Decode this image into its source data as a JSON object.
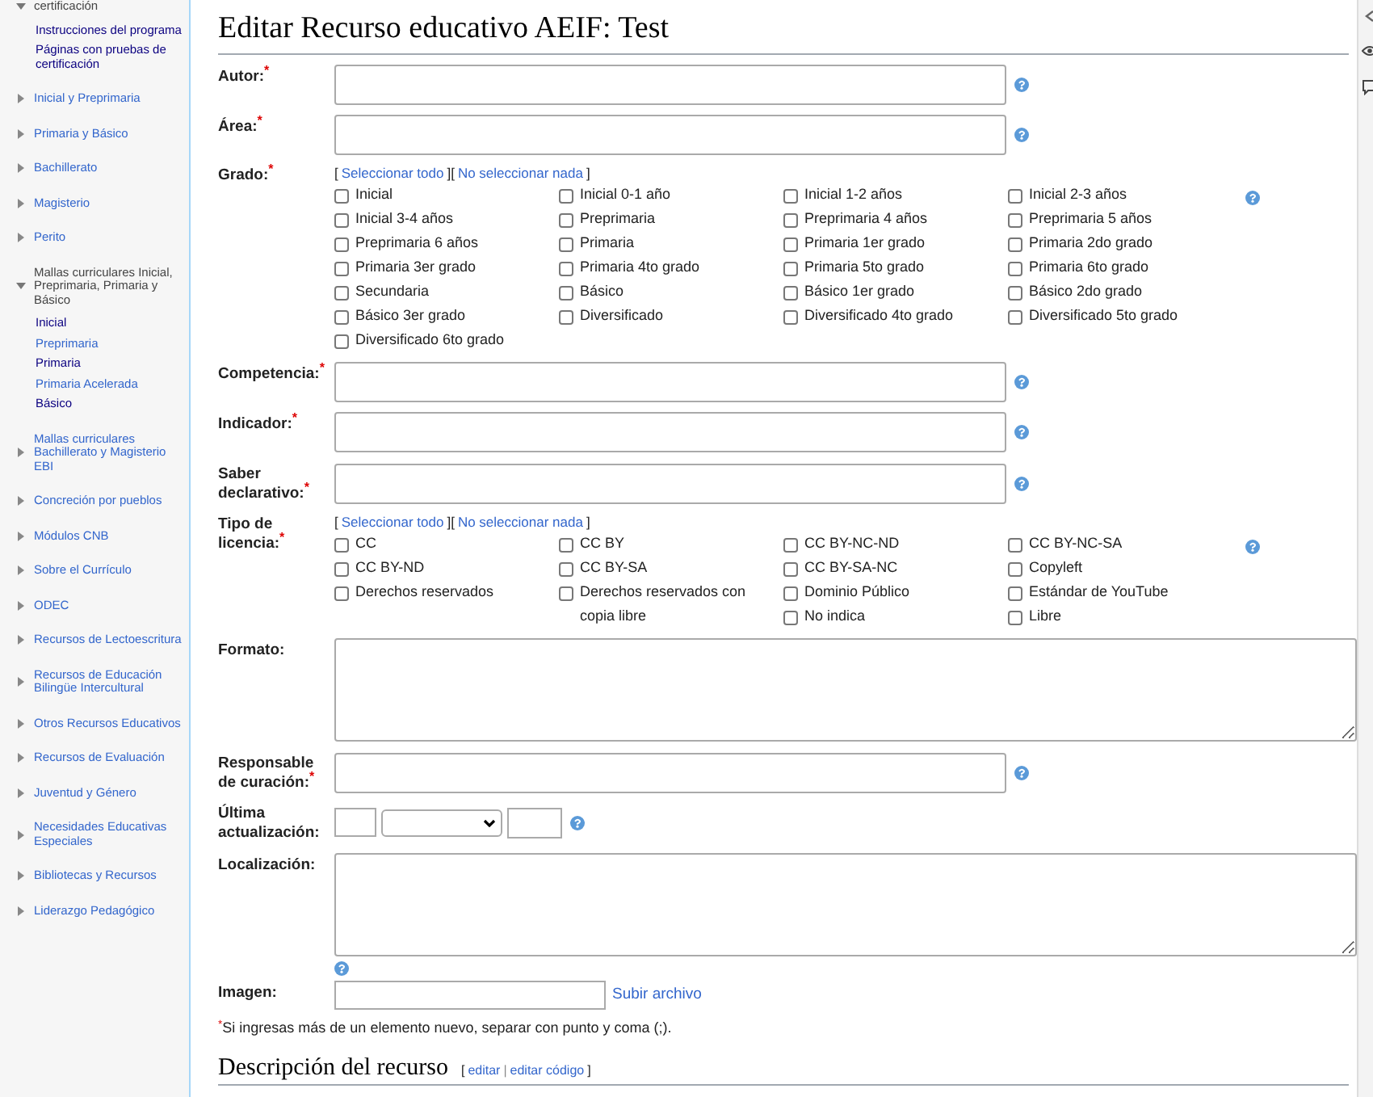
{
  "sidebar": {
    "items": [
      {
        "label": "certificación",
        "expanded": true,
        "children": [
          {
            "label": "Instrucciones del programa",
            "visited": true
          },
          {
            "label": "Páginas con pruebas de certificación",
            "visited": true
          }
        ]
      },
      {
        "label": "Inicial y Preprimaria",
        "expanded": false
      },
      {
        "label": "Primaria y Básico",
        "expanded": false
      },
      {
        "label": "Bachillerato",
        "expanded": false
      },
      {
        "label": "Magisterio",
        "expanded": false
      },
      {
        "label": "Perito",
        "expanded": false
      },
      {
        "label": "Mallas curriculares Inicial, Preprimaria, Primaria y Básico",
        "expanded": true,
        "children": [
          {
            "label": "Inicial",
            "visited": true
          },
          {
            "label": "Preprimaria",
            "visited": false
          },
          {
            "label": "Primaria",
            "visited": true
          },
          {
            "label": "Primaria Acelerada",
            "visited": false
          },
          {
            "label": "Básico",
            "visited": true
          }
        ]
      },
      {
        "label": "Mallas curriculares Bachillerato y Magisterio EBI",
        "expanded": false
      },
      {
        "label": "Concreción por pueblos",
        "expanded": false
      },
      {
        "label": "Módulos CNB",
        "expanded": false
      },
      {
        "label": "Sobre el Currículo",
        "expanded": false
      },
      {
        "label": "ODEC",
        "expanded": false
      },
      {
        "label": "Recursos de Lectoescritura",
        "expanded": false
      },
      {
        "label": "Recursos de Educación Bilingüe Intercultural",
        "expanded": false
      },
      {
        "label": "Otros Recursos Educativos",
        "expanded": false
      },
      {
        "label": "Recursos de Evaluación",
        "expanded": false
      },
      {
        "label": "Juventud y Género",
        "expanded": false
      },
      {
        "label": "Necesidades Educativas Especiales",
        "expanded": false
      },
      {
        "label": "Bibliotecas y Recursos",
        "expanded": false
      },
      {
        "label": "Liderazgo Pedagógico",
        "expanded": false
      }
    ]
  },
  "title": "Editar Recurso educativo AEIF: Test",
  "required_mark": "*",
  "fields": [
    {
      "kind": "text",
      "label": "Autor:",
      "required": true
    },
    {
      "kind": "text",
      "label": "Área:",
      "required": true
    },
    {
      "kind": "checkboxes",
      "label": "Grado:",
      "required": true,
      "brackets": [
        "[",
        "][",
        "]"
      ],
      "select_all": "Seleccionar todo",
      "select_none": "No seleccionar nada",
      "columns": [
        [
          {
            "label": "Inicial",
            "checked": false
          },
          {
            "label": "Inicial 3-4 años",
            "checked": false
          },
          {
            "label": "Preprimaria 6 años",
            "checked": false
          },
          {
            "label": "Primaria 3er grado",
            "checked": false
          },
          {
            "label": "Secundaria",
            "checked": false
          },
          {
            "label": "Básico 3er grado",
            "checked": false
          },
          {
            "label": "Diversificado 6to grado",
            "checked": false
          }
        ],
        [
          {
            "label": "Inicial 0-1 año",
            "checked": false
          },
          {
            "label": "Preprimaria",
            "checked": false
          },
          {
            "label": "Primaria",
            "checked": false
          },
          {
            "label": "Primaria 4to grado",
            "checked": false
          },
          {
            "label": "Básico",
            "checked": false
          },
          {
            "label": "Diversificado",
            "checked": false
          }
        ],
        [
          {
            "label": "Inicial 1-2 años",
            "checked": false
          },
          {
            "label": "Preprimaria 4 años",
            "checked": false
          },
          {
            "label": "Primaria 1er grado",
            "checked": false
          },
          {
            "label": "Primaria 5to grado",
            "checked": false
          },
          {
            "label": "Básico 1er grado",
            "checked": false
          },
          {
            "label": "Diversificado 4to grado",
            "checked": false
          }
        ],
        [
          {
            "label": "Inicial 2-3 años",
            "checked": false
          },
          {
            "label": "Preprimaria 5 años",
            "checked": false
          },
          {
            "label": "Primaria 2do grado",
            "checked": false
          },
          {
            "label": "Primaria 6to grado",
            "checked": false
          },
          {
            "label": "Básico 2do grado",
            "checked": false
          },
          {
            "label": "Diversificado 5to grado",
            "checked": false
          }
        ]
      ]
    },
    {
      "kind": "text",
      "label": "Competencia:",
      "required": true
    },
    {
      "kind": "text",
      "label": "Indicador:",
      "required": true
    },
    {
      "kind": "text",
      "label": "Saber declarativo:",
      "required": true
    },
    {
      "kind": "checkboxes",
      "label": "Tipo de licencia:",
      "required": true,
      "brackets": [
        "[",
        "][",
        "]"
      ],
      "select_all": "Seleccionar todo",
      "select_none": "No seleccionar nada",
      "columns": [
        [
          {
            "label": "CC",
            "checked": false
          },
          {
            "label": "CC BY-ND",
            "checked": false
          },
          {
            "label": "Derechos reservados",
            "checked": false
          }
        ],
        [
          {
            "label": "CC BY",
            "checked": false
          },
          {
            "label": "CC BY-SA",
            "checked": false
          },
          {
            "label": "Derechos reservados con copia libre",
            "checked": false
          }
        ],
        [
          {
            "label": "CC BY-NC-ND",
            "checked": false
          },
          {
            "label": "CC BY-SA-NC",
            "checked": false
          },
          {
            "label": "Dominio Público",
            "checked": false
          },
          {
            "label": "No indica",
            "checked": false
          }
        ],
        [
          {
            "label": "CC BY-NC-SA",
            "checked": false
          },
          {
            "label": "Copyleft",
            "checked": false
          },
          {
            "label": "Estándar de YouTube",
            "checked": false
          },
          {
            "label": "Libre",
            "checked": false
          }
        ]
      ]
    },
    {
      "kind": "textarea",
      "label": "Formato:",
      "required": false
    },
    {
      "kind": "text",
      "label": "Responsable de curación:",
      "required": true
    },
    {
      "kind": "date",
      "label": "Última actualización:",
      "required": false
    },
    {
      "kind": "textarea",
      "label": "Localización:",
      "required": false
    },
    {
      "kind": "file",
      "label": "Imagen:",
      "required": false,
      "link": "Subir archivo"
    }
  ],
  "note": "Si ingresas más de un elemento nuevo, separar con punto y coma (;).",
  "section": {
    "heading": "Descripción del recurso",
    "links": [
      "editar",
      "editar código"
    ],
    "bracket_open": "[",
    "separator": "|",
    "bracket_close": "]"
  }
}
